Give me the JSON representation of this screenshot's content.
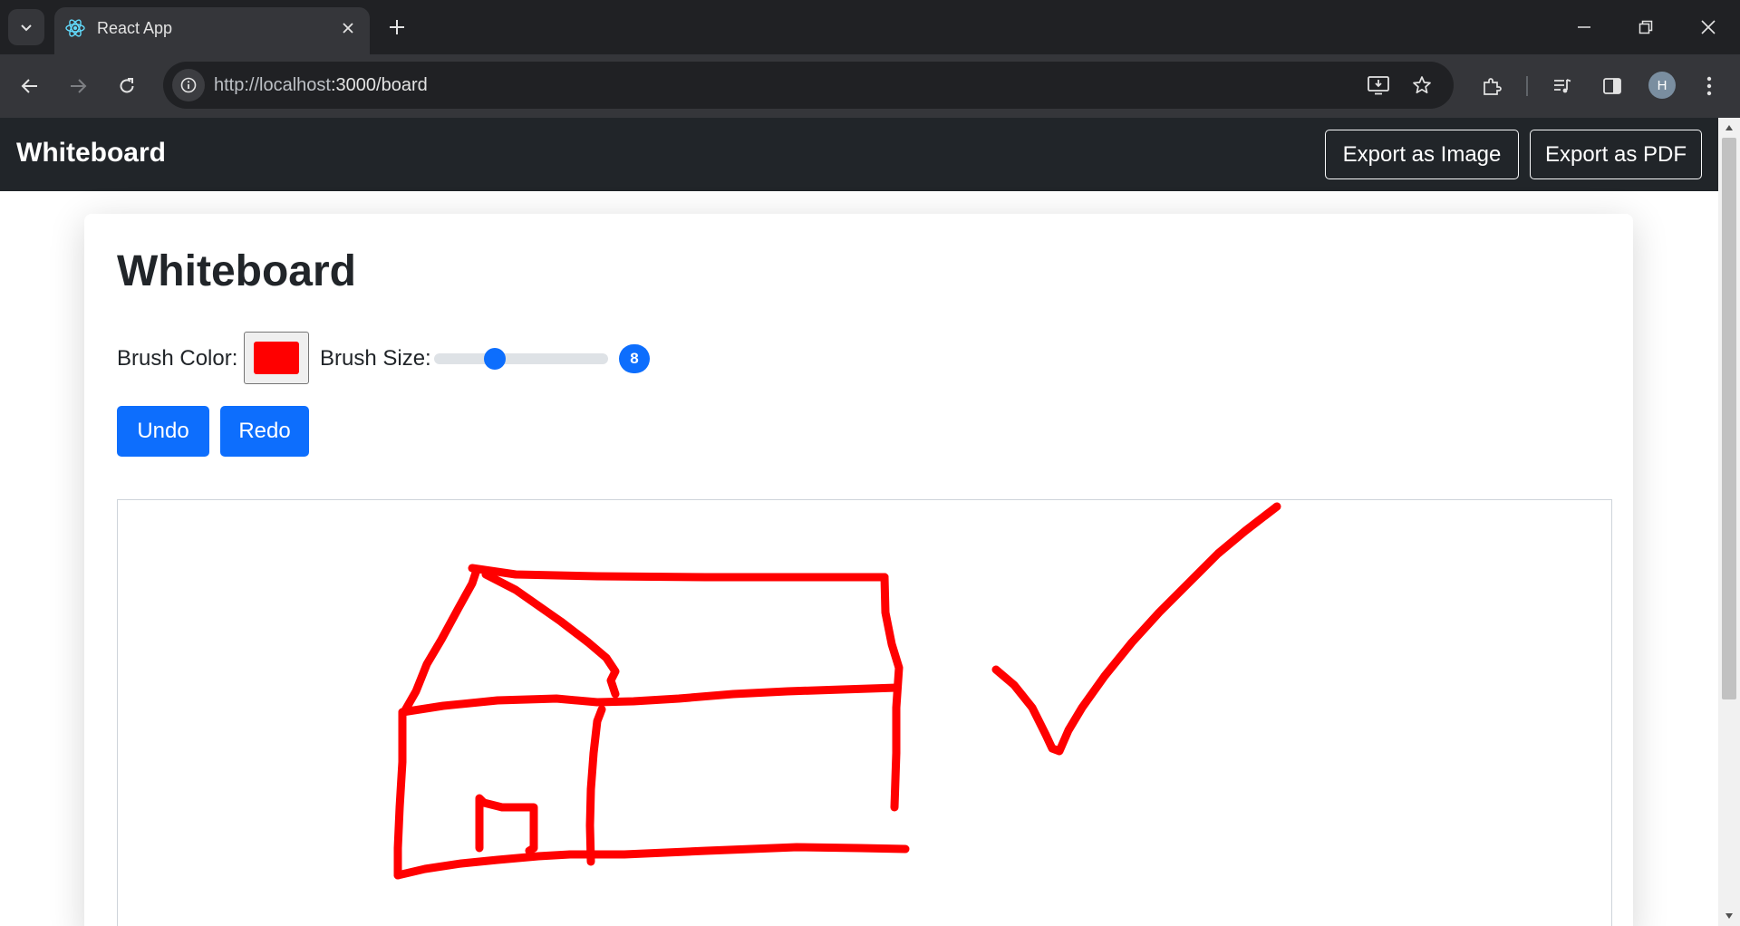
{
  "browser": {
    "tab_title": "React App",
    "url_host": "http://localhost",
    "url_rest": ":3000/board",
    "profile_initial": "H"
  },
  "app": {
    "brand": "Whiteboard",
    "export_image_label": "Export as Image",
    "export_pdf_label": "Export as PDF"
  },
  "board": {
    "title": "Whiteboard",
    "brush_color_label": "Brush Color:",
    "brush_color": "#ff0000",
    "brush_size_label": "Brush Size:",
    "brush_size": "8",
    "brush_size_fraction": 0.35,
    "undo_label": "Undo",
    "redo_label": "Redo"
  },
  "colors": {
    "accent": "#0d6efd",
    "navbar": "#212529",
    "stroke": "#ff0000"
  },
  "icons": [
    "tab-search-icon",
    "react-favicon-icon",
    "close-icon",
    "plus-icon",
    "minimize-icon",
    "restore-icon",
    "back-icon",
    "forward-icon",
    "reload-icon",
    "site-info-icon",
    "install-app-icon",
    "star-icon",
    "extensions-icon",
    "media-control-icon",
    "side-panel-icon",
    "kebab-menu-icon"
  ]
}
